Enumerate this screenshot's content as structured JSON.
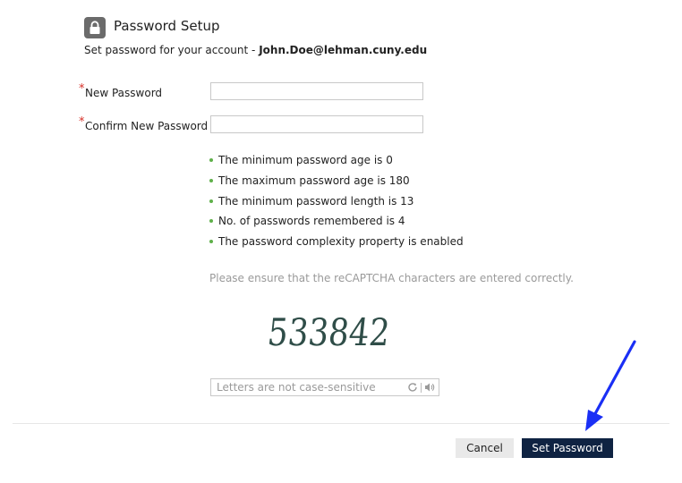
{
  "header": {
    "title": "Password Setup",
    "subtitle_prefix": "Set password for your account - ",
    "account_email": "John.Doe@lehman.cuny.edu"
  },
  "form": {
    "new_password": {
      "label": "New Password",
      "required_mark": "*",
      "value": ""
    },
    "confirm_password": {
      "label": "Confirm New Password",
      "required_mark": "*",
      "value": ""
    }
  },
  "rules": [
    "The minimum password age is 0",
    "The maximum password age is 180",
    "The minimum password length is 13",
    "No. of passwords remembered is 4",
    "The password complexity property is enabled"
  ],
  "captcha": {
    "note": "Please ensure that the reCAPTCHA characters are entered correctly.",
    "text": "533842",
    "input_placeholder": "Letters are not case-sensitive",
    "refresh_icon": "refresh-icon",
    "audio_icon": "speaker-icon"
  },
  "buttons": {
    "cancel": "Cancel",
    "submit": "Set Password"
  },
  "colors": {
    "primary_button": "#0f2342",
    "required_star": "#d8322a",
    "rule_bullet": "#5fb04a",
    "annotation_arrow": "#1a2ff5"
  }
}
